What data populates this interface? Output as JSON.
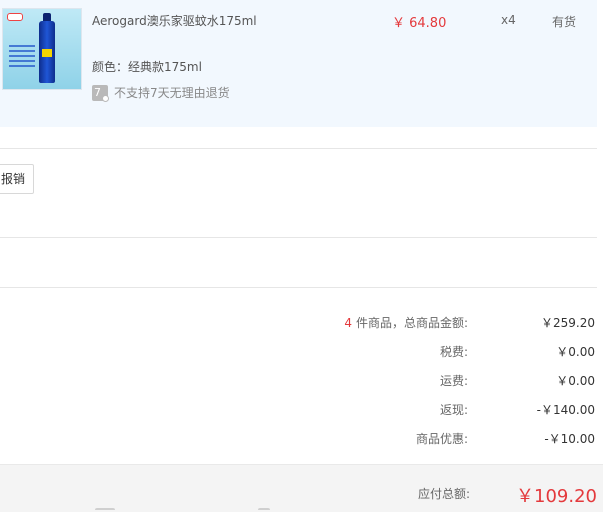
{
  "product": {
    "title": "Aerogard澳乐家驱蚊水175ml",
    "price": "￥ 64.80",
    "quantity": "x4",
    "stock_status": "有货",
    "color": "颜色：经典款175ml",
    "return_icon_text": "7",
    "return_policy": "不支持7天无理由退货"
  },
  "actions": {
    "reimburse_label": "报销"
  },
  "summary": {
    "item_count": "4",
    "items_total_label": "件商品，总商品金额:",
    "items_total_value": "￥259.20",
    "tax_label": "税费:",
    "tax_value": "￥0.00",
    "shipping_label": "运费:",
    "shipping_value": "￥0.00",
    "cashback_label": "返现:",
    "cashback_value": "-￥140.00",
    "discount_label": "商品优惠:",
    "discount_value": "-￥10.00",
    "payable_label": "应付总额:",
    "payable_value": "￥109.20"
  },
  "colors": {
    "price_red": "#e4393c",
    "panel_bg": "#f2f8fe",
    "total_bar_bg": "#f4f4f4"
  }
}
